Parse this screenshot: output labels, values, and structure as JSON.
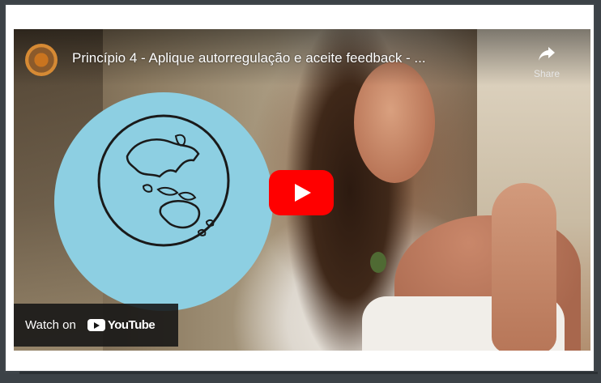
{
  "video": {
    "title": "Princípio 4 - Aplique autorregulação e aceite feedback - ...",
    "share_label": "Share",
    "watch_on_label": "Watch on",
    "youtube_label": "YouTube"
  },
  "colors": {
    "play_button": "#ff0000",
    "globe_disc": "#8dcfe2",
    "overlay_bar": "#141414"
  },
  "icons": {
    "share": "share-arrow-icon",
    "play": "play-icon",
    "youtube": "youtube-logo-icon",
    "globe": "globe-oceania-icon"
  }
}
